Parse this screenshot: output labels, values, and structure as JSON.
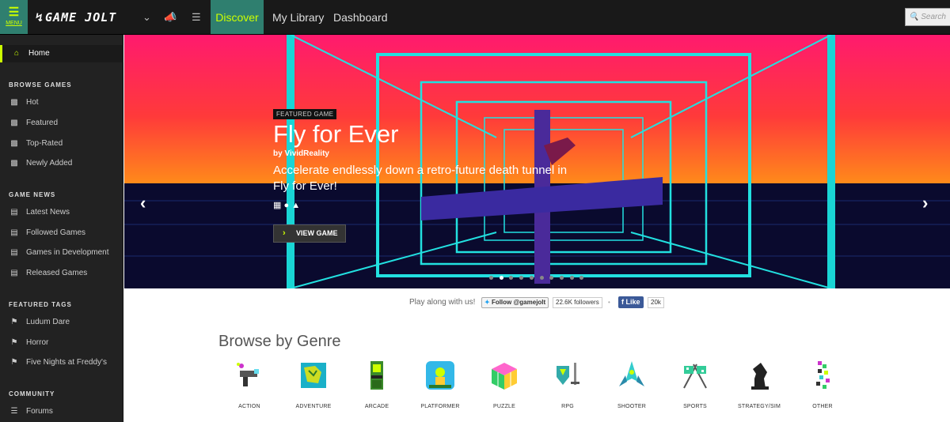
{
  "topbar": {
    "menu_label": "MENU",
    "logo_text": "GAME JOLT",
    "nav": [
      {
        "label": "Discover",
        "active": true
      },
      {
        "label": "My Library",
        "active": false
      },
      {
        "label": "Dashboard",
        "active": false
      }
    ],
    "search_placeholder": "Search",
    "accent_color": "#ccff00",
    "active_bg": "#2f7f6f"
  },
  "sidebar": {
    "home": "Home",
    "sections": [
      {
        "heading": "BROWSE GAMES",
        "items": [
          "Hot",
          "Featured",
          "Top-Rated",
          "Newly Added"
        ]
      },
      {
        "heading": "GAME NEWS",
        "items": [
          "Latest News",
          "Followed Games",
          "Games in Development",
          "Released Games"
        ]
      },
      {
        "heading": "FEATURED TAGS",
        "items": [
          "Ludum Dare",
          "Horror",
          "Five Nights at Freddy's"
        ]
      },
      {
        "heading": "COMMUNITY",
        "items": [
          "Forums"
        ]
      }
    ]
  },
  "featured": {
    "tag": "FEATURED GAME",
    "title": "Fly for Ever",
    "by": "by VividReality",
    "description": "Accelerate endlessly down a retro-future death tunnel in Fly for Ever!",
    "platforms": [
      "windows-icon",
      "apple-icon",
      "linux-icon"
    ],
    "button_label": "VIEW GAME",
    "slide_count": 10,
    "active_slide": 2
  },
  "follow": {
    "play_along": "Play along with us!",
    "twitter_label": "Follow @gamejolt",
    "twitter_count": "22.6K followers",
    "facebook_label": "Like",
    "facebook_count": "20k"
  },
  "genres": {
    "title": "Browse by Genre",
    "items": [
      "ACTION",
      "ADVENTURE",
      "ARCADE",
      "PLATFORMER",
      "PUZZLE",
      "RPG",
      "SHOOTER",
      "SPORTS",
      "STRATEGY/SIM",
      "OTHER"
    ]
  }
}
